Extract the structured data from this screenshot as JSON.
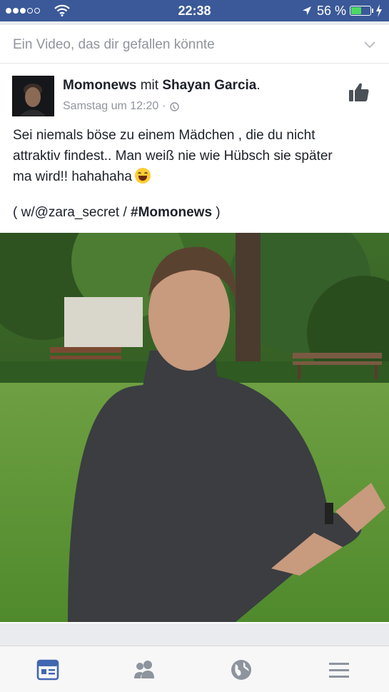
{
  "status_bar": {
    "time": "22:38",
    "battery_percent": "56 %",
    "battery_level": 0.56,
    "signal_bars_on": 3,
    "signal_bars_total": 5
  },
  "feed": {
    "suggestion_header": "Ein Video, das dir gefallen könnte"
  },
  "post": {
    "page_name": "Momonews",
    "connector": "mit",
    "tagged_name": "Shayan Garcia",
    "trailing_punct": ".",
    "timestamp": "Samstag um 12:20",
    "meta_separator": "·",
    "privacy_icon": "globe-icon",
    "text_line1": "Sei niemals böse zu einem Mädchen , die du nicht",
    "text_line2": "attraktiv findest.. Man weiß nie wie Hübsch sie später",
    "text_line3": "ma wird!! hahahaha",
    "emoji": "face-with-tears-of-joy",
    "tags_prefix": "( w/@zara_secret / ",
    "hashtag": "#Momonews",
    "tags_suffix": " )"
  },
  "video": {
    "description_icon": "video-thumbnail"
  },
  "tab_bar": {
    "icons": [
      "news-feed-icon",
      "friends-icon",
      "globe-icon",
      "menu-icon"
    ],
    "active_color": "#4267b2",
    "inactive_color": "#8d949e"
  },
  "colors": {
    "brand": "#3b5998",
    "battery_green": "#4cd964"
  }
}
